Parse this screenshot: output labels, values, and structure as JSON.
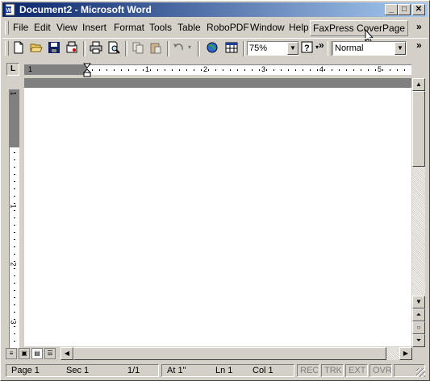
{
  "window": {
    "title": "Document2 - Microsoft Word",
    "caption_buttons": {
      "minimize": "_",
      "maximize": "□",
      "close": "✕"
    }
  },
  "menu": {
    "items": [
      {
        "label": "File",
        "name": "menu-file"
      },
      {
        "label": "Edit",
        "name": "menu-edit"
      },
      {
        "label": "View",
        "name": "menu-view"
      },
      {
        "label": "Insert",
        "name": "menu-insert"
      },
      {
        "label": "Format",
        "name": "menu-format"
      },
      {
        "label": "Tools",
        "name": "menu-tools"
      },
      {
        "label": "Table",
        "name": "menu-table"
      },
      {
        "label": "RoboPDF",
        "name": "menu-robopdf"
      },
      {
        "label": "Window",
        "name": "menu-window"
      },
      {
        "label": "Help",
        "name": "menu-help"
      },
      {
        "label": "FaxPress CoverPage",
        "name": "menu-faxpress-coverpage"
      }
    ],
    "overflow": "»"
  },
  "toolbar": {
    "icons": [
      "new-document-icon",
      "open-folder-icon",
      "save-icon",
      "permission-icon",
      "print-icon",
      "print-preview-icon",
      "copy-icon",
      "paste-icon",
      "undo-icon",
      "web-icon",
      "insert-table-icon",
      "help-icon"
    ],
    "zoom": "75%",
    "style": "Normal",
    "overflow": "»"
  },
  "ruler": {
    "tab_selector": "L",
    "h_numbers": [
      "1",
      "1",
      "2",
      "3",
      "4",
      "5"
    ],
    "v_numbers": [
      "1",
      "1",
      "2",
      "3"
    ]
  },
  "status": {
    "page": "Page 1",
    "section": "Sec 1",
    "page_of": "1/1",
    "at": "At 1\"",
    "line": "Ln 1",
    "col": "Col 1",
    "rec": "REC",
    "trk": "TRK",
    "ext": "EXT",
    "ovr": "OVR"
  }
}
